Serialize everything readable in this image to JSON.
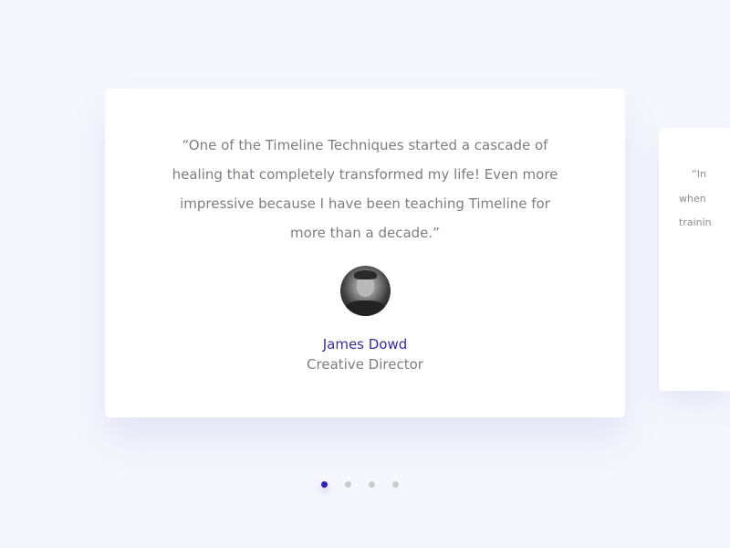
{
  "testimonials": [
    {
      "quote": "“One of the Timeline Techniques started a cascade of healing that completely transformed my life! Even more impressive because I have been teaching Timeline for more than a decade.”",
      "name": "James Dowd",
      "role": "Creative Director"
    },
    {
      "quote_lines": [
        "“In",
        "when",
        "trainin"
      ]
    }
  ],
  "pagination": {
    "count": 4,
    "active": 1
  },
  "colors": {
    "accent": "#2d22b4",
    "name": "#3a2d9c",
    "text": "#7d7d85",
    "background": "#f6f7fd"
  }
}
